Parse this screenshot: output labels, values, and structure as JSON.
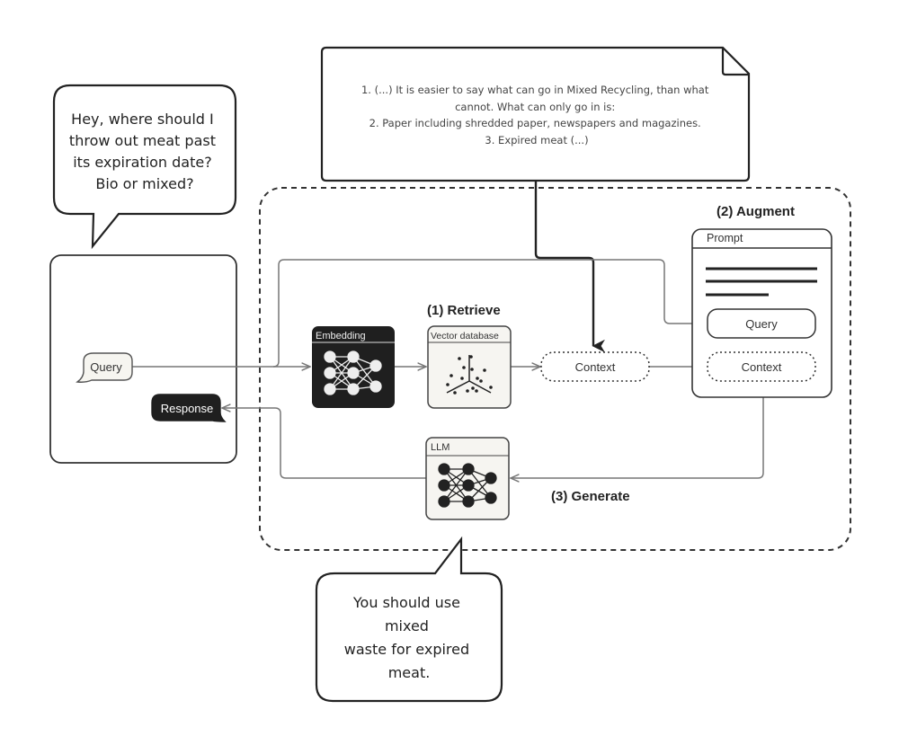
{
  "user_bubble": {
    "lines": [
      "Hey, where should I",
      "throw out meat past",
      "its expiration date?",
      "Bio or mixed?"
    ]
  },
  "document_note": {
    "lines": [
      "1. (...) It is easier to say what can go in Mixed Recycling, than what",
      "cannot. What can only go in is:",
      "2. Paper including shredded paper, newspapers and magazines.",
      "3. Expired meat (...)"
    ]
  },
  "answer_bubble": {
    "lines": [
      "You should use",
      "mixed",
      "waste for expired",
      "meat."
    ]
  },
  "client": {
    "query_label": "Query",
    "response_label": "Response"
  },
  "pipeline": {
    "embedding_label": "Embedding",
    "vector_db_label": "Vector database",
    "retrieve_step": "(1) Retrieve",
    "context_label": "Context",
    "augment_step": "(2) Augment",
    "prompt_label": "Prompt",
    "prompt_query_label": "Query",
    "prompt_context_label": "Context",
    "llm_label": "LLM",
    "generate_step": "(3) Generate"
  },
  "colors": {
    "ink": "#222222",
    "line": "#777777",
    "dark_fill": "#1f1f1f",
    "light_fill": "#f4f4f2"
  }
}
